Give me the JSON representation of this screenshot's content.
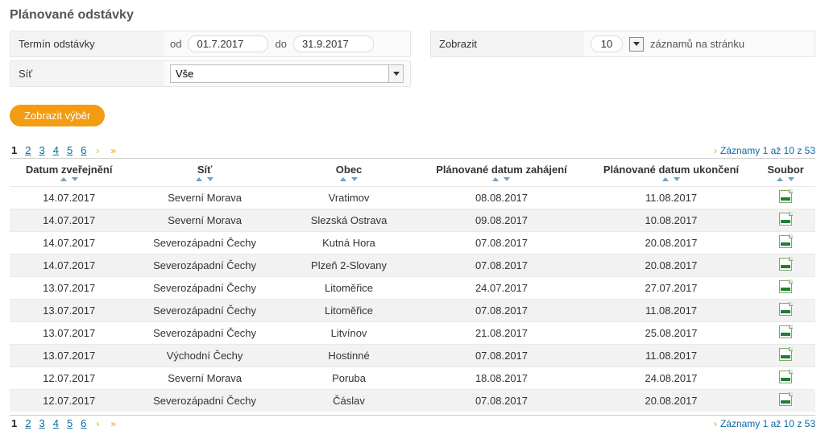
{
  "title": "Plánované odstávky",
  "filters": {
    "term_label": "Termín odstávky",
    "od_label": "od",
    "od_value": "01.7.2017",
    "do_label": "do",
    "do_value": "31.9.2017",
    "zobrazit_label": "Zobrazit",
    "per_page": "10",
    "per_page_suffix": "záznamů na stránku",
    "sit_label": "Síť",
    "sit_value": "Vše"
  },
  "actions": {
    "submit": "Zobrazit výběr"
  },
  "pager": {
    "pages": [
      "1",
      "2",
      "3",
      "4",
      "5",
      "6"
    ],
    "active": "1",
    "info": "Záznamy 1 až 10 z 53"
  },
  "columns": {
    "pub": "Datum zveřejnění",
    "net": "Síť",
    "obec": "Obec",
    "start": "Plánované datum zahájení",
    "end": "Plánované datum ukončení",
    "file": "Soubor"
  },
  "rows": [
    {
      "pub": "14.07.2017",
      "net": "Severní Morava",
      "obec": "Vratimov",
      "start": "08.08.2017",
      "end": "11.08.2017"
    },
    {
      "pub": "14.07.2017",
      "net": "Severní Morava",
      "obec": "Slezská Ostrava",
      "start": "09.08.2017",
      "end": "10.08.2017"
    },
    {
      "pub": "14.07.2017",
      "net": "Severozápadní Čechy",
      "obec": "Kutná Hora",
      "start": "07.08.2017",
      "end": "20.08.2017"
    },
    {
      "pub": "14.07.2017",
      "net": "Severozápadní Čechy",
      "obec": "Plzeň 2-Slovany",
      "start": "07.08.2017",
      "end": "20.08.2017"
    },
    {
      "pub": "13.07.2017",
      "net": "Severozápadní Čechy",
      "obec": "Litoměřice",
      "start": "24.07.2017",
      "end": "27.07.2017"
    },
    {
      "pub": "13.07.2017",
      "net": "Severozápadní Čechy",
      "obec": "Litoměřice",
      "start": "07.08.2017",
      "end": "11.08.2017"
    },
    {
      "pub": "13.07.2017",
      "net": "Severozápadní Čechy",
      "obec": "Litvínov",
      "start": "21.08.2017",
      "end": "25.08.2017"
    },
    {
      "pub": "13.07.2017",
      "net": "Východní Čechy",
      "obec": "Hostinné",
      "start": "07.08.2017",
      "end": "11.08.2017"
    },
    {
      "pub": "12.07.2017",
      "net": "Severní Morava",
      "obec": "Poruba",
      "start": "18.08.2017",
      "end": "24.08.2017"
    },
    {
      "pub": "12.07.2017",
      "net": "Severozápadní Čechy",
      "obec": "Čáslav",
      "start": "07.08.2017",
      "end": "20.08.2017"
    }
  ]
}
